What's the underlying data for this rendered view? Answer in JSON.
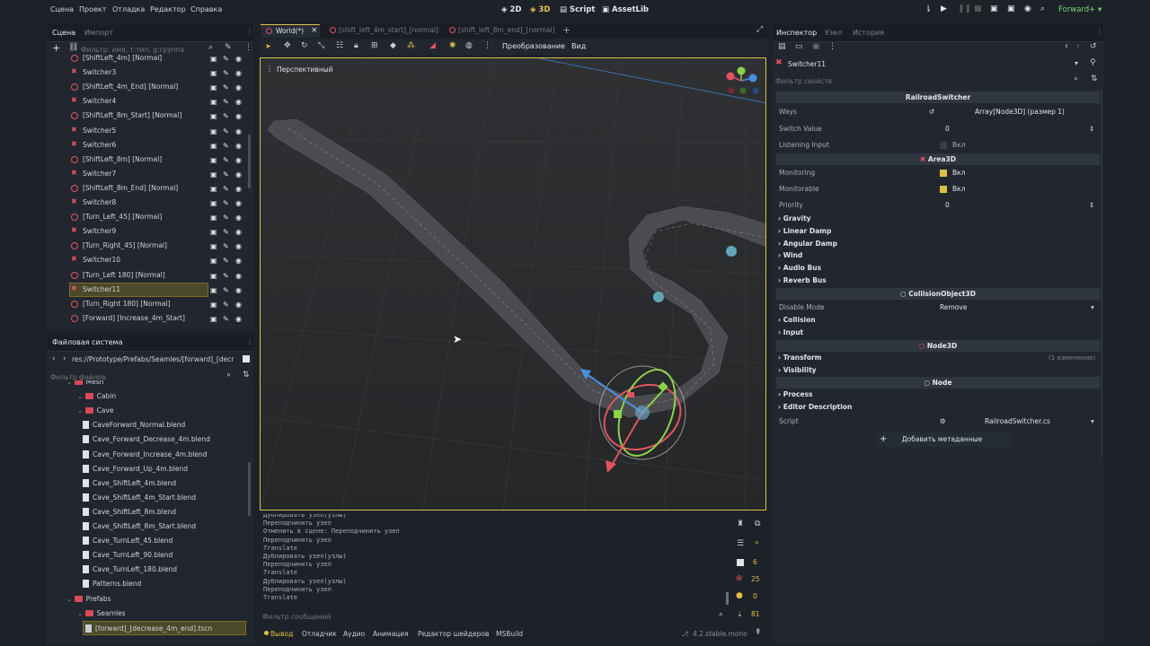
{
  "menubar": {
    "items": [
      "Сцена",
      "Проект",
      "Отладка",
      "Редактор",
      "Справка"
    ],
    "modes": [
      "2D",
      "3D",
      "Script",
      "AssetLib"
    ],
    "renderer": "Forward+"
  },
  "scene_dock": {
    "tabs": [
      "Сцена",
      "Импорт"
    ],
    "filter_placeholder": "Фильтр: имя, т:тип, g:группа",
    "nodes": [
      {
        "label": "[ShiftLeft_4m] [Normal]",
        "type": "ring"
      },
      {
        "label": "Switcher3",
        "type": "area"
      },
      {
        "label": "[ShiftLeft_4m_End] [Normal]",
        "type": "ring"
      },
      {
        "label": "Switcher4",
        "type": "area"
      },
      {
        "label": "[ShiftLeft_8m_Start] [Normal]",
        "type": "ring"
      },
      {
        "label": "Switcher5",
        "type": "area"
      },
      {
        "label": "Switcher6",
        "type": "area"
      },
      {
        "label": "[ShiftLeft_8m] [Normal]",
        "type": "ring"
      },
      {
        "label": "Switcher7",
        "type": "area"
      },
      {
        "label": "[ShiftLeft_8m_End] [Normal]",
        "type": "ring"
      },
      {
        "label": "Switcher8",
        "type": "area"
      },
      {
        "label": "[Turn_Left_45] [Normal]",
        "type": "ring"
      },
      {
        "label": "Switcher9",
        "type": "area"
      },
      {
        "label": "[Turn_Right_45] [Normal]",
        "type": "ring"
      },
      {
        "label": "Switcher10",
        "type": "area"
      },
      {
        "label": "[Turn_Left 180] [Normal]",
        "type": "ring"
      },
      {
        "label": "Switcher11",
        "type": "area",
        "selected": true
      },
      {
        "label": "[Turn_Right 180] [Normal]",
        "type": "ring"
      },
      {
        "label": "[Forward] [Increase_4m_Start]",
        "type": "ring"
      }
    ]
  },
  "filesystem": {
    "title": "Файловая система",
    "path": "res://Prototype/Prefabs/Seamles/[forward]_[decr",
    "filter_placeholder": "Фильтр файлов",
    "entries": [
      {
        "label": "Mesh",
        "kind": "folder",
        "indent": 0
      },
      {
        "label": "Cabin",
        "kind": "folder",
        "indent": 1
      },
      {
        "label": "Cave",
        "kind": "folder",
        "indent": 1
      },
      {
        "label": "CaveForward_Normal.blend",
        "kind": "file",
        "indent": 2
      },
      {
        "label": "Cave_Forward_Decrease_4m.blend",
        "kind": "file",
        "indent": 2
      },
      {
        "label": "Cave_Forward_Increase_4m.blend",
        "kind": "file",
        "indent": 2
      },
      {
        "label": "Cave_Forward_Up_4m.blend",
        "kind": "file",
        "indent": 2
      },
      {
        "label": "Cave_ShiftLeft_4m.blend",
        "kind": "file",
        "indent": 2
      },
      {
        "label": "Cave_ShiftLeft_4m_Start.blend",
        "kind": "file",
        "indent": 2
      },
      {
        "label": "Cave_ShiftLeft_8m.blend",
        "kind": "file",
        "indent": 2
      },
      {
        "label": "Cave_ShiftLeft_8m_Start.blend",
        "kind": "file",
        "indent": 2
      },
      {
        "label": "Cave_TurnLeft_45.blend",
        "kind": "file",
        "indent": 2
      },
      {
        "label": "Cave_TurnLeft_90.blend",
        "kind": "file",
        "indent": 2
      },
      {
        "label": "Cave_TurnLeft_180.blend",
        "kind": "file",
        "indent": 2
      },
      {
        "label": "Patterns.blend",
        "kind": "file",
        "indent": 2
      },
      {
        "label": "Prefabs",
        "kind": "folder",
        "indent": 0
      },
      {
        "label": "Seamles",
        "kind": "folder",
        "indent": 1
      },
      {
        "label": "[forward]_[decrease_4m_end].tscn",
        "kind": "scene",
        "indent": 2,
        "selected": true
      }
    ]
  },
  "editor_tabs": [
    {
      "label": "World(*)",
      "active": true
    },
    {
      "label": "[shift_left_4m_start]_[normal]",
      "active": false
    },
    {
      "label": "[shift_left_8m_end]_[normal]",
      "active": false
    }
  ],
  "viewport": {
    "toolbar_labels": [
      "Преобразование",
      "Вид"
    ],
    "perspective_label": "Перспективный"
  },
  "output": {
    "lines": [
      "Дублировать узел(узлы)",
      "Переподчинить узел",
      "Отменить в сцене: Переподчинить узел",
      "Переподчинить узел",
      "Translate",
      "Дублировать узел(узлы)",
      "Переподчинить узел",
      "Translate",
      "Дублировать узел(узлы)",
      "Переподчинить узел",
      "Translate"
    ],
    "filter_placeholder": "Фильтр сообщений",
    "counts": {
      "messages": "6",
      "errors": "25",
      "warnings": "0",
      "info": "81"
    }
  },
  "bottom_tabs": [
    "Вывод",
    "Отладчик",
    "Аудио",
    "Анимация",
    "Редактор шейдеров",
    "MSBuild"
  ],
  "version": "4.2.stable.mono",
  "inspector": {
    "tabs": [
      "Инспектор",
      "Узел",
      "История"
    ],
    "node_name": "Switcher11",
    "filter_placeholder": "Фильтр свойств",
    "class_railroad": "RailroadSwitcher",
    "ways_label": "Ways",
    "ways_value": "Array[Node3D] (размер 1)",
    "switch_value_label": "Switch Value",
    "switch_value": "0",
    "listening_input_label": "Listening Input",
    "listening_input_value": "Вкл",
    "class_area": "Area3D",
    "monitoring_label": "Monitoring",
    "monitoring_value": "Вкл",
    "monitorable_label": "Monitorable",
    "monitorable_value": "Вкл",
    "priority_label": "Priority",
    "priority_value": "0",
    "area_groups": [
      "Gravity",
      "Linear Damp",
      "Angular Damp",
      "Wind",
      "Audio Bus",
      "Reverb Bus"
    ],
    "class_collision": "CollisionObject3D",
    "disable_mode_label": "Disable Mode",
    "disable_mode_value": "Remove",
    "collision_groups": [
      "Collision",
      "Input"
    ],
    "class_node3d": "Node3D",
    "transform_label": "Transform",
    "transform_note": "(1 изменение)",
    "visibility_label": "Visibility",
    "class_node": "Node",
    "node_groups": [
      "Process",
      "Editor Description"
    ],
    "script_label": "Script",
    "script_value": "RailroadSwitcher.cs",
    "add_metadata": "Добавить метаданные"
  },
  "colors": {
    "accent": "#e0c044",
    "selection": "#4a4a2b",
    "error": "#e0545f",
    "folder": "#d94a5a"
  }
}
